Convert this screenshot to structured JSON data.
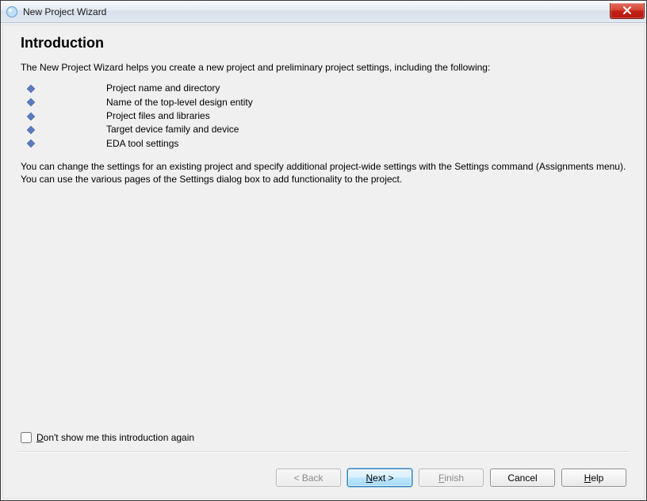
{
  "window": {
    "title": "New Project Wizard"
  },
  "page": {
    "heading": "Introduction",
    "intro": "The New Project Wizard helps you create a new project and preliminary project settings, including the following:",
    "bullets": [
      "Project name and directory",
      "Name of the top-level design entity",
      "Project files and libraries",
      "Target device family and device",
      "EDA tool settings"
    ],
    "description": "You can change the settings for an existing project and specify additional project-wide settings with the Settings command (Assignments menu). You can use the various pages of the Settings dialog box to add functionality to the project.",
    "dont_show_prefix": "D",
    "dont_show_rest": "on't show me this introduction again"
  },
  "buttons": {
    "back": "< Back",
    "next_prefix": "N",
    "next_rest": "ext >",
    "finish_prefix": "F",
    "finish_rest": "inish",
    "cancel": "Cancel",
    "help_prefix": "H",
    "help_rest": "elp"
  }
}
